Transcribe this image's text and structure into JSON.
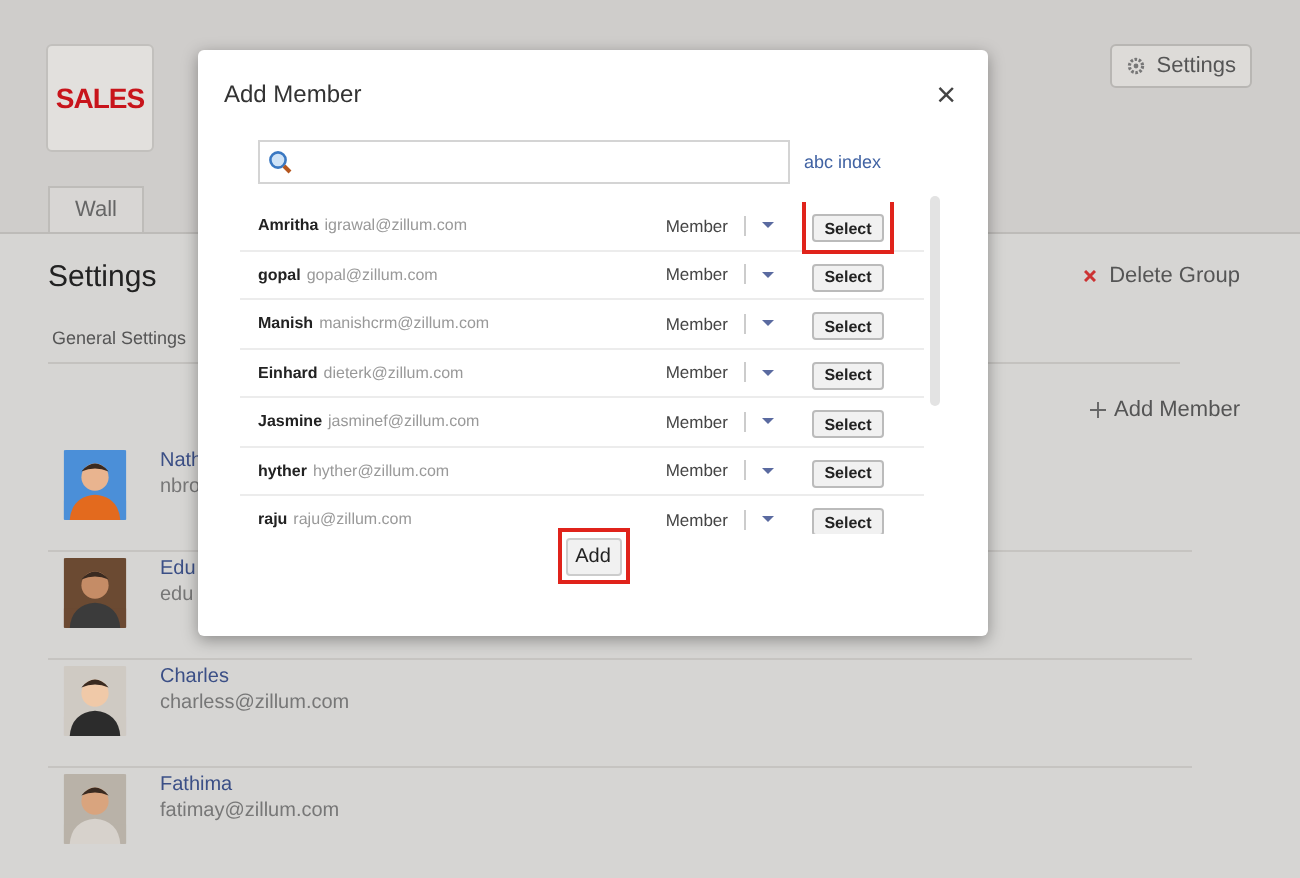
{
  "group": {
    "logo_text": "SALES"
  },
  "settings_button": {
    "label": "Settings"
  },
  "tabs": [
    {
      "label": "Wall",
      "selected": true
    }
  ],
  "section": {
    "title": "Settings",
    "delete_label": "Delete Group",
    "subtab": "General Settings",
    "add_label": "Add Member"
  },
  "members": [
    {
      "name": "Nath",
      "email": "nbro"
    },
    {
      "name": "Edu",
      "email": "edu"
    },
    {
      "name": "Charles",
      "email": "charless@zillum.com"
    },
    {
      "name": "Fathima",
      "email": "fatimay@zillum.com"
    }
  ],
  "dialog": {
    "title": "Add Member",
    "close": "×",
    "index_link": "abc index",
    "rows": [
      {
        "name": "Amritha",
        "email": "igrawal@zillum.com",
        "role": "Member",
        "button": "Select",
        "highlighted": true
      },
      {
        "name": "gopal",
        "email": "gopal@zillum.com",
        "role": "Member",
        "button": "Select",
        "highlighted": false
      },
      {
        "name": "Manish",
        "email": "manishcrm@zillum.com",
        "role": "Member",
        "button": "Select",
        "highlighted": false
      },
      {
        "name": "Einhard",
        "email": "dieterk@zillum.com",
        "role": "Member",
        "button": "Select",
        "highlighted": false
      },
      {
        "name": "Jasmine",
        "email": "jasminef@zillum.com",
        "role": "Member",
        "button": "Select",
        "highlighted": false
      },
      {
        "name": "hyther",
        "email": "hyther@zillum.com",
        "role": "Member",
        "button": "Select",
        "highlighted": false
      },
      {
        "name": "raju",
        "email": "raju@zillum.com",
        "role": "Member",
        "button": "Select",
        "highlighted": false
      }
    ],
    "add_button": {
      "label": "Add",
      "highlighted": true
    }
  }
}
